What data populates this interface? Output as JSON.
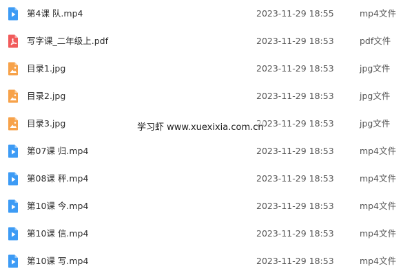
{
  "colors": {
    "video_icon": "#3d9bf5",
    "pdf_icon": "#f15b5b",
    "image_icon": "#f7a24a"
  },
  "files": [
    {
      "icon": "video-file-icon",
      "name": "第4课 队.mp4",
      "date": "2023-11-29 18:55",
      "type": "mp4文件"
    },
    {
      "icon": "pdf-file-icon",
      "name": "写字课_二年级上.pdf",
      "date": "2023-11-29 18:53",
      "type": "pdf文件"
    },
    {
      "icon": "image-file-icon",
      "name": "目录1.jpg",
      "date": "2023-11-29 18:53",
      "type": "jpg文件"
    },
    {
      "icon": "image-file-icon",
      "name": "目录2.jpg",
      "date": "2023-11-29 18:53",
      "type": "jpg文件"
    },
    {
      "icon": "image-file-icon",
      "name": "目录3.jpg",
      "date": "2023-11-29 18:53",
      "type": "jpg文件"
    },
    {
      "icon": "video-file-icon",
      "name": "第07课 归.mp4",
      "date": "2023-11-29 18:53",
      "type": "mp4文件"
    },
    {
      "icon": "video-file-icon",
      "name": "第08课 秤.mp4",
      "date": "2023-11-29 18:53",
      "type": "mp4文件"
    },
    {
      "icon": "video-file-icon",
      "name": "第10课 今.mp4",
      "date": "2023-11-29 18:53",
      "type": "mp4文件"
    },
    {
      "icon": "video-file-icon",
      "name": "第10课 信.mp4",
      "date": "2023-11-29 18:53",
      "type": "mp4文件"
    },
    {
      "icon": "video-file-icon",
      "name": "第10课 写.mp4",
      "date": "2023-11-29 18:53",
      "type": "mp4文件"
    }
  ],
  "watermark": "学习虾 www.xuexixia.com.cn"
}
